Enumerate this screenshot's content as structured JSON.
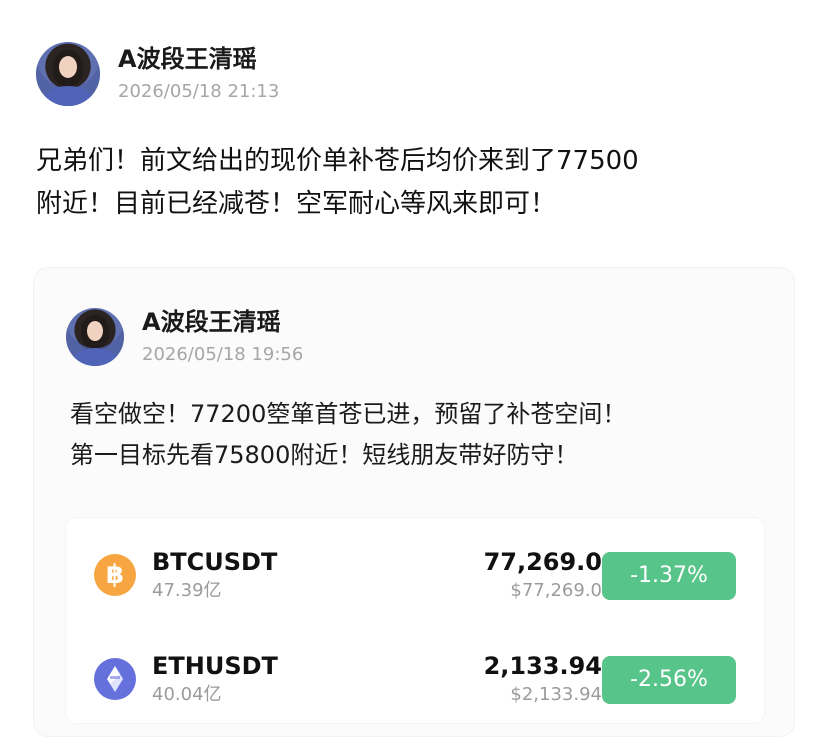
{
  "post": {
    "author": "A波段王清瑶",
    "time": "2026/05/18 21:13",
    "content": "兄弟们！前文给出的现价单补苍后均价来到了77500\n附近！目前已经减苍！空军耐心等风来即可！"
  },
  "quote": {
    "author": "A波段王清瑶",
    "time": "2026/05/18 19:56",
    "content": "看空做空！77200箜箪首苍已进，预留了补苍空间！\n第一目标先看75800附近！短线朋友带好防守！",
    "markets": [
      {
        "symbol": "BTCUSDT",
        "volume": "47.39亿",
        "price": "77,269.0",
        "fiat": "$77,269.0",
        "change": "-1.37%",
        "icon": "bitcoin-icon",
        "icon_text": "฿"
      },
      {
        "symbol": "ETHUSDT",
        "volume": "40.04亿",
        "price": "2,133.94",
        "fiat": "$2,133.94",
        "change": "-2.56%",
        "icon": "ethereum-icon"
      }
    ]
  },
  "colors": {
    "change_badge": "#57c489",
    "bitcoin": "#f6a540",
    "ethereum": "#6670dd"
  }
}
